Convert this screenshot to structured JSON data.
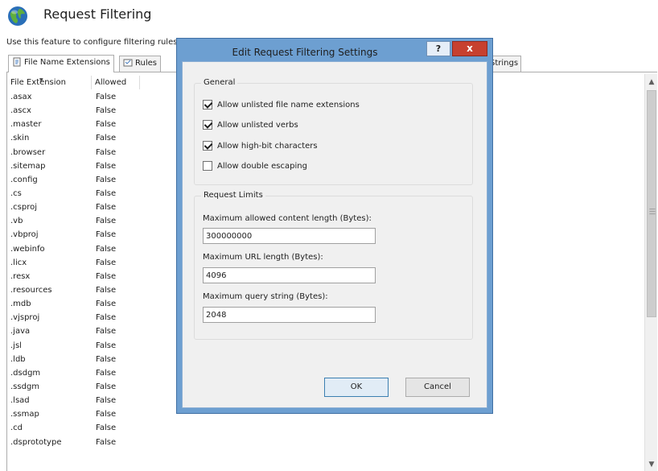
{
  "page": {
    "title": "Request Filtering",
    "description": "Use this feature to configure filtering rules"
  },
  "tabs": [
    {
      "label": "File Name Extensions"
    },
    {
      "label": "Rules"
    },
    {
      "label": "Strings"
    }
  ],
  "list": {
    "columns": [
      "File Extension",
      "Allowed"
    ],
    "rows": [
      [
        ".asax",
        "False"
      ],
      [
        ".ascx",
        "False"
      ],
      [
        ".master",
        "False"
      ],
      [
        ".skin",
        "False"
      ],
      [
        ".browser",
        "False"
      ],
      [
        ".sitemap",
        "False"
      ],
      [
        ".config",
        "False"
      ],
      [
        ".cs",
        "False"
      ],
      [
        ".csproj",
        "False"
      ],
      [
        ".vb",
        "False"
      ],
      [
        ".vbproj",
        "False"
      ],
      [
        ".webinfo",
        "False"
      ],
      [
        ".licx",
        "False"
      ],
      [
        ".resx",
        "False"
      ],
      [
        ".resources",
        "False"
      ],
      [
        ".mdb",
        "False"
      ],
      [
        ".vjsproj",
        "False"
      ],
      [
        ".java",
        "False"
      ],
      [
        ".jsl",
        "False"
      ],
      [
        ".ldb",
        "False"
      ],
      [
        ".dsdgm",
        "False"
      ],
      [
        ".ssdgm",
        "False"
      ],
      [
        ".lsad",
        "False"
      ],
      [
        ".ssmap",
        "False"
      ],
      [
        ".cd",
        "False"
      ],
      [
        ".dsprototype",
        "False"
      ]
    ]
  },
  "dialog": {
    "title": "Edit Request Filtering Settings",
    "help_label": "?",
    "close_label": "x",
    "general": {
      "label": "General",
      "options": [
        {
          "label": "Allow unlisted file name extensions",
          "checked": true
        },
        {
          "label": "Allow unlisted verbs",
          "checked": true
        },
        {
          "label": "Allow high-bit characters",
          "checked": true
        },
        {
          "label": "Allow double escaping",
          "checked": false
        }
      ]
    },
    "limits": {
      "label": "Request Limits",
      "max_content_length_label": "Maximum allowed content length (Bytes):",
      "max_content_length_value": "300000000",
      "max_url_label": "Maximum URL length (Bytes):",
      "max_url_value": "4096",
      "max_query_label": "Maximum query string (Bytes):",
      "max_query_value": "2048"
    },
    "ok_label": "OK",
    "cancel_label": "Cancel"
  },
  "colors": {
    "dialog_frame": "#6d9fd1",
    "close_button": "#c7402f"
  }
}
